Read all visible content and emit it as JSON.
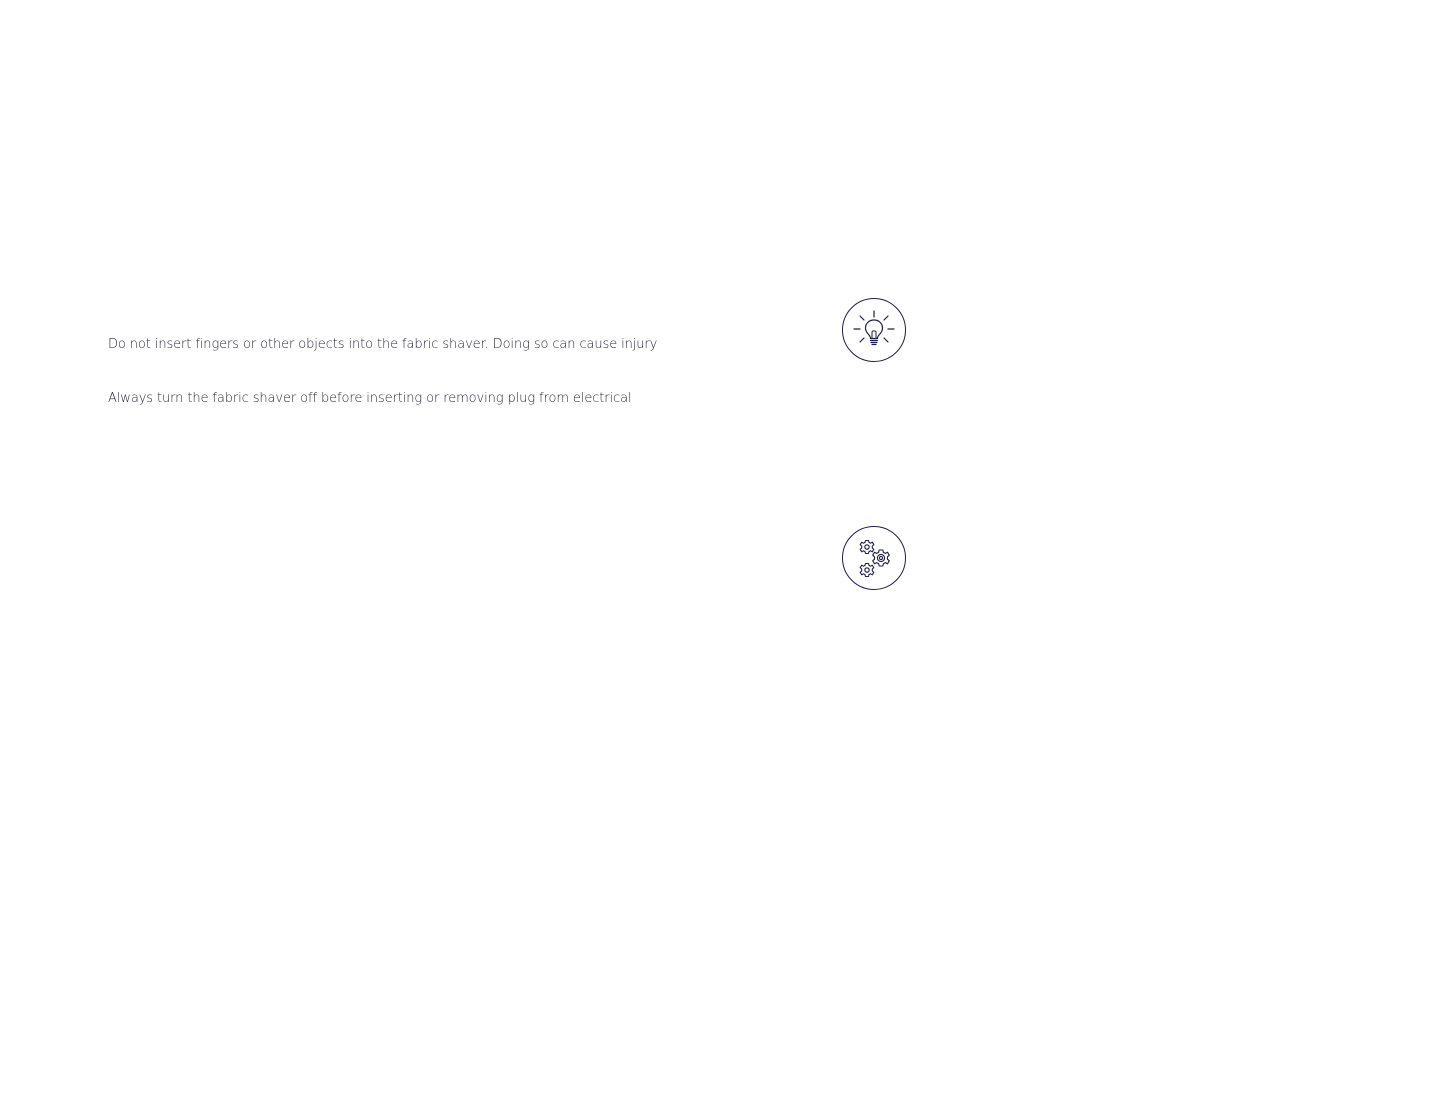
{
  "warnings": [
    "Do not insert fingers or other objects into the fabric shaver. Doing so can cause injury",
    "Always turn the fabric shaver off before inserting or removing plug from electrical"
  ],
  "icons": {
    "tip": "lightbulb-icon",
    "settings": "gears-icon"
  },
  "colors": {
    "text": "#2a2a3a",
    "icon_stroke": "#1f1f4a"
  }
}
